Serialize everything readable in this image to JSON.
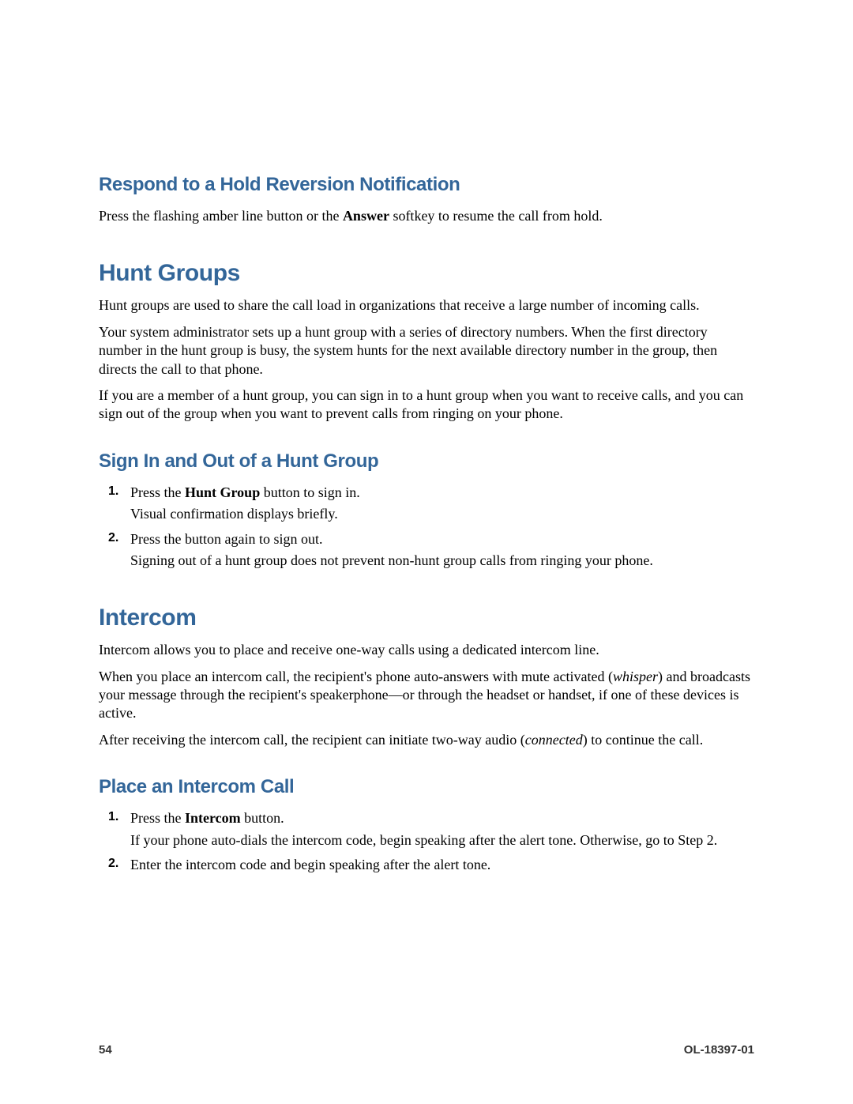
{
  "respond": {
    "title": "Respond to a Hold Reversion Notification",
    "p1_a": "Press the flashing amber line button or the ",
    "p1_b": "Answer",
    "p1_c": " softkey to resume the call from hold."
  },
  "hunt": {
    "title": "Hunt Groups",
    "p1": "Hunt groups are used to share the call load in organizations that receive a large number of incoming calls.",
    "p2": "Your system administrator sets up a hunt group with a series of directory numbers. When the first directory number in the hunt group is busy, the system hunts for the next available directory number in the group, then directs the call to that phone.",
    "p3": "If you are a member of a hunt group, you can sign in to a hunt group when you want to receive calls, and you can sign out of the group when you want to prevent calls from ringing on your phone."
  },
  "signin": {
    "title": "Sign In and Out of a Hunt Group",
    "s1a": "Press the ",
    "s1b": "Hunt Group",
    "s1c": " button to sign in.",
    "s1sub": "Visual confirmation displays briefly.",
    "s2": "Press the button again to sign out.",
    "s2sub": "Signing out of a hunt group does not prevent non-hunt group calls from ringing your phone."
  },
  "intercom": {
    "title": "Intercom",
    "p1": "Intercom allows you to place and receive one-way calls using a dedicated intercom line.",
    "p2a": "When you place an intercom call, the recipient's phone auto-answers with mute activated (",
    "p2b": "whisper",
    "p2c": ") and broadcasts your message through the recipient's speakerphone—or through the headset or handset, if one of these devices is active.",
    "p3a": "After receiving the intercom call, the recipient can initiate two-way audio (",
    "p3b": "connected",
    "p3c": ") to continue the call."
  },
  "place": {
    "title": "Place an Intercom Call",
    "s1a": "Press the ",
    "s1b": "Intercom",
    "s1c": " button.",
    "s1sub": "If your phone auto-dials the intercom code, begin speaking after the alert tone. Otherwise, go to Step 2.",
    "s2": "Enter the intercom code and begin speaking after the alert tone."
  },
  "footer": {
    "page": "54",
    "docid": "OL-18397-01"
  }
}
